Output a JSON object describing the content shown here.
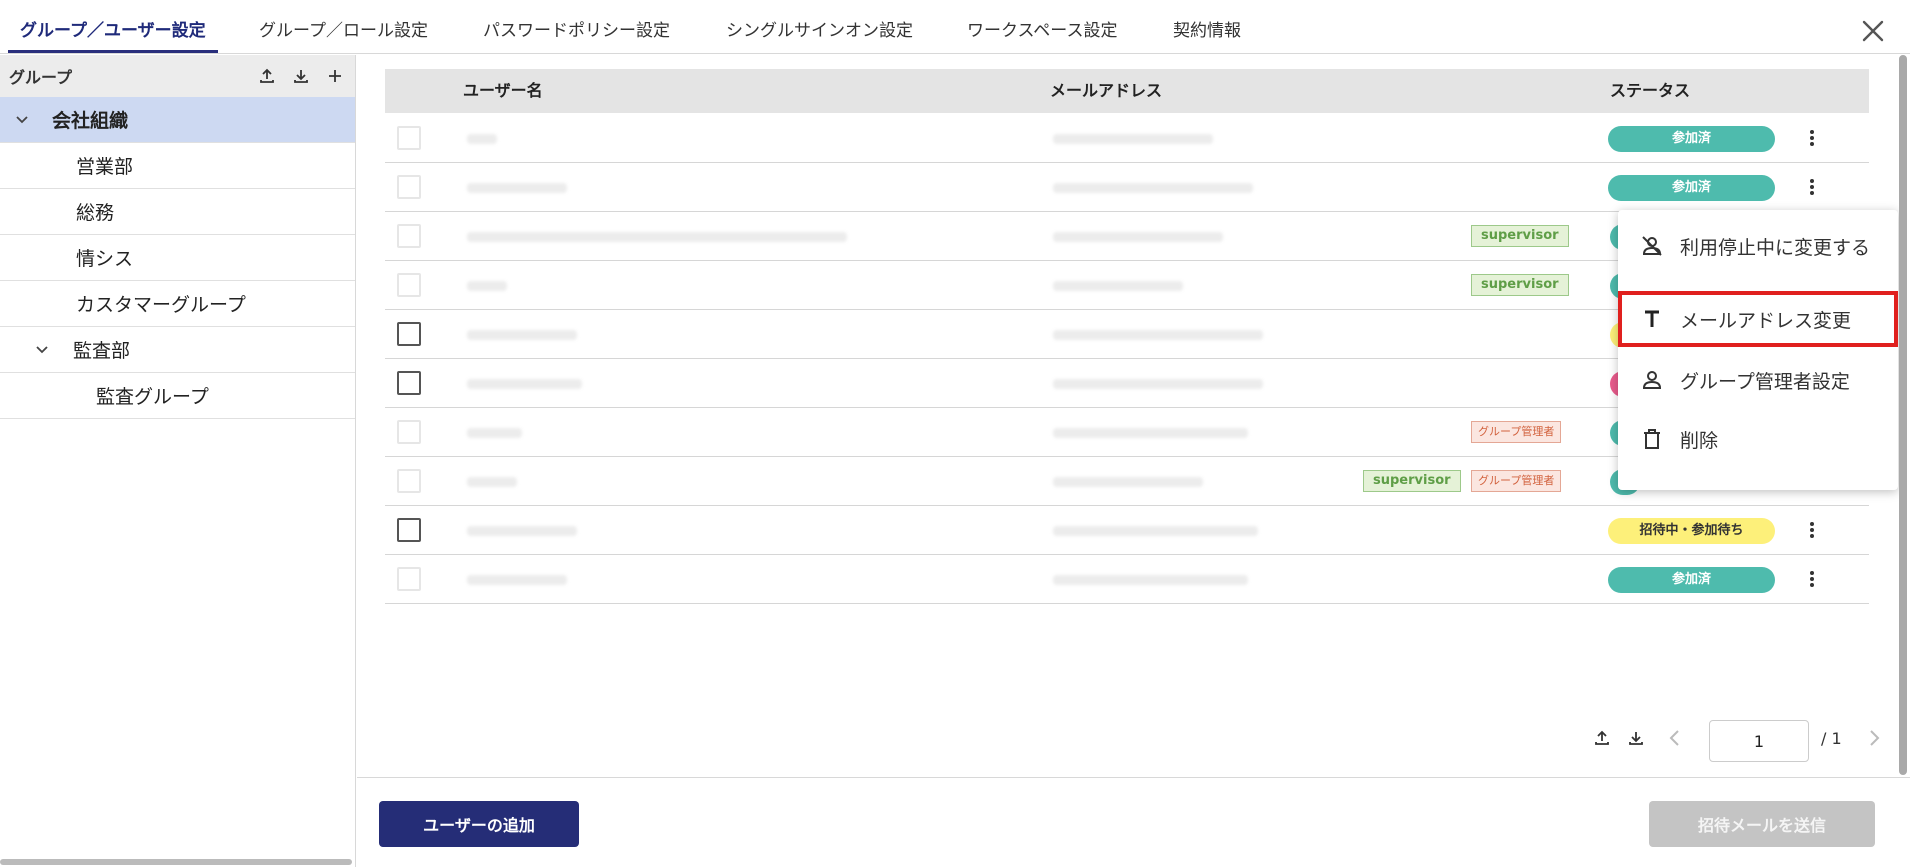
{
  "tabs": [
    {
      "label": "グループ／ユーザー設定"
    },
    {
      "label": "グループ／ロール設定"
    },
    {
      "label": "パスワードポリシー設定"
    },
    {
      "label": "シングルサインオン設定"
    },
    {
      "label": "ワークスペース設定"
    },
    {
      "label": "契約情報"
    }
  ],
  "sidebar": {
    "header": "グループ",
    "icons": [
      "upload-icon",
      "download-icon",
      "plus-icon"
    ],
    "items": [
      {
        "label": "会社組織",
        "expanded": true,
        "selected": true
      },
      {
        "label": "営業部"
      },
      {
        "label": "総務"
      },
      {
        "label": "情シス"
      },
      {
        "label": "カスタマーグループ"
      },
      {
        "label": "監査部",
        "expanded": true
      },
      {
        "label": "監査グループ"
      }
    ]
  },
  "table": {
    "headers": {
      "name": "ユーザー名",
      "email": "メールアドレス",
      "status": "ステータス"
    },
    "tags": {
      "supervisor": "supervisor",
      "group_admin": "グループ管理者"
    },
    "status_labels": {
      "joined": "参加済",
      "invited": "招待中・参加待ち"
    }
  },
  "menu": {
    "items": [
      {
        "label": "利用停止中に変更する",
        "icon": "person-off-icon"
      },
      {
        "label": "メールアドレス変更",
        "icon": "text-icon"
      },
      {
        "label": "グループ管理者設定",
        "icon": "person-icon"
      },
      {
        "label": "削除",
        "icon": "trash-icon"
      }
    ]
  },
  "pagination": {
    "current": "1",
    "total": "/ 1"
  },
  "footer": {
    "add_user": "ユーザーの追加",
    "send_invite": "招待メールを送信"
  },
  "colors": {
    "accent": "#252d77",
    "joined": "#4ebbad",
    "invited": "#fdf07a",
    "highlight": "#e0201e"
  }
}
